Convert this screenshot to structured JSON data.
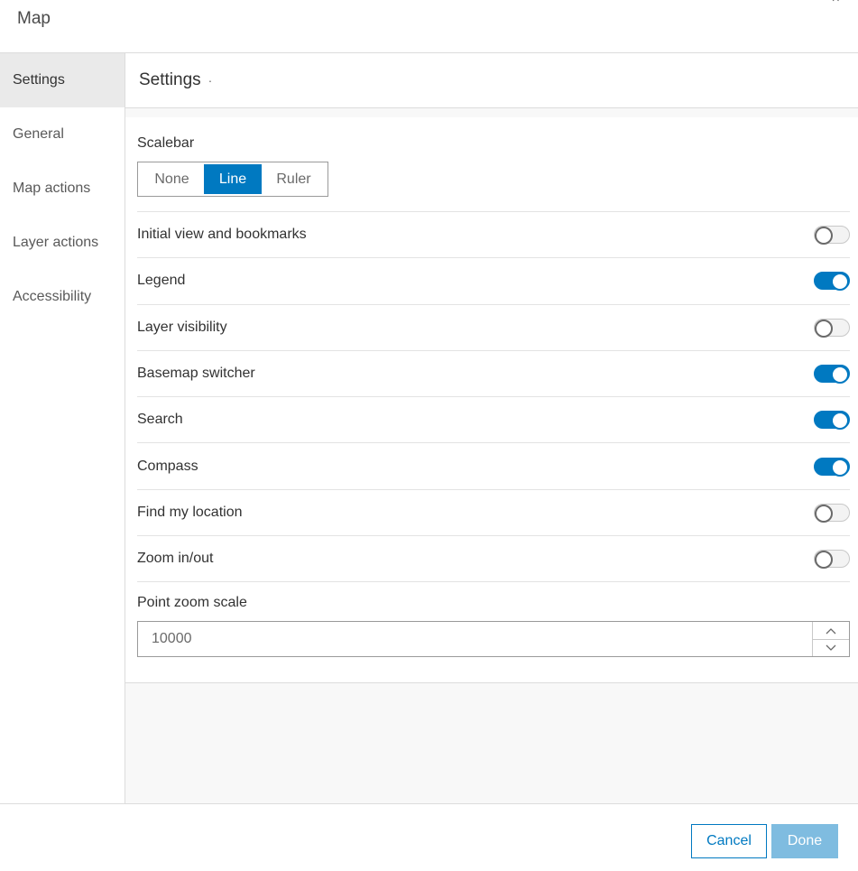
{
  "header": {
    "title": "Map",
    "close_glyph": "×"
  },
  "sidebar": {
    "items": [
      {
        "label": "Settings",
        "active": true
      },
      {
        "label": "General",
        "active": false
      },
      {
        "label": "Map actions",
        "active": false
      },
      {
        "label": "Layer actions",
        "active": false
      },
      {
        "label": "Accessibility",
        "active": false
      }
    ]
  },
  "main": {
    "title": "Settings",
    "title_dot": "·",
    "scalebar": {
      "label": "Scalebar",
      "options": [
        "None",
        "Line",
        "Ruler"
      ],
      "selected": "Line"
    },
    "toggles": [
      {
        "label": "Initial view and bookmarks",
        "on": false
      },
      {
        "label": "Legend",
        "on": true
      },
      {
        "label": "Layer visibility",
        "on": false
      },
      {
        "label": "Basemap switcher",
        "on": true
      },
      {
        "label": "Search",
        "on": true
      },
      {
        "label": "Compass",
        "on": true
      },
      {
        "label": "Find my location",
        "on": false
      },
      {
        "label": "Zoom in/out",
        "on": false
      }
    ],
    "point_zoom": {
      "label": "Point zoom scale",
      "value": "10000"
    }
  },
  "footer": {
    "cancel_label": "Cancel",
    "done_label": "Done"
  },
  "colors": {
    "accent": "#0079c1",
    "done_disabled": "#7fbce0"
  }
}
